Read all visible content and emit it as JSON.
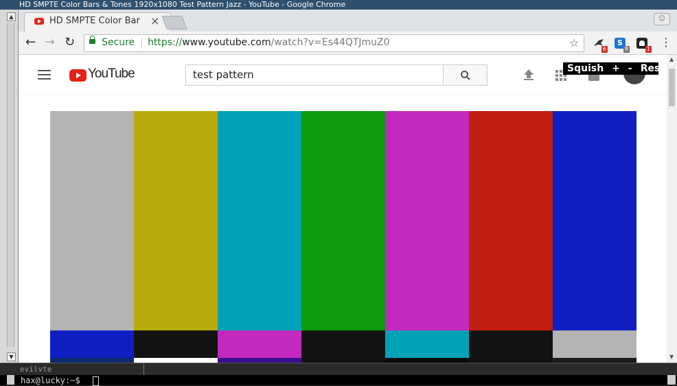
{
  "window": {
    "title": "HD SMPTE Color Bars & Tones 1920x1080 Test Pattern Jazz - YouTube - Google Chrome"
  },
  "tab": {
    "title": "HD SMPTE Color Bar",
    "close": "×"
  },
  "toolbar": {
    "back": "←",
    "forward": "→",
    "reload": "↻",
    "secure_label": "Secure",
    "url_scheme": "https://",
    "url_host": "www.youtube.com",
    "url_path": "/watch?v=Es44QTJmuZ0",
    "star": "☆",
    "menu": "⋮",
    "extensions": [
      {
        "icon": "bird-extension-icon",
        "badge": "6",
        "color": "#333",
        "badge_color": "#d32f2f"
      },
      {
        "icon": "s-extension-icon",
        "badge": "8",
        "color": "#1976d2",
        "badge_color": "#757575"
      },
      {
        "icon": "ghost-extension-icon",
        "badge": "1",
        "color": "#222",
        "badge_color": "#d32f2f"
      }
    ]
  },
  "youtube": {
    "logo_text": "YouTube",
    "search_value": "test pattern",
    "squish": {
      "label": "Squish",
      "plus": "+",
      "minus": "-",
      "reset": "Reset"
    }
  },
  "video": {
    "top_bars": [
      "#b4b4b4",
      "#b8a90e",
      "#00a2b8",
      "#0d9a0f",
      "#c22abe",
      "#c11f11",
      "#0e1fc4"
    ],
    "middle_bars": [
      "#0e1fc4",
      "#131313",
      "#c22abe",
      "#131313",
      "#00a2b8",
      "#131313",
      "#b4b4b4"
    ],
    "bottom_bars": [
      "#0c2a6e",
      "#ffffff",
      "#3a0e8e",
      "#131313",
      "#0a0a0a",
      "#131313",
      "#1a1a1a"
    ]
  },
  "terminal": {
    "tab_label": "evilvte",
    "prompt": "hax@lucky:~$ "
  }
}
